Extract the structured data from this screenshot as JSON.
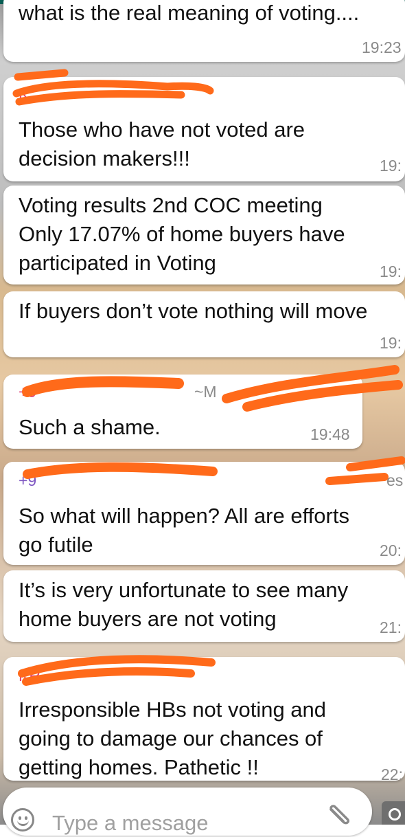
{
  "messages": [
    {
      "id": "m1",
      "text": "what is the real meaning of voting....",
      "time": "19:23"
    },
    {
      "id": "m2",
      "sender": "K",
      "text": "Those who have not voted are\ndecision makers!!!",
      "time": "19:"
    },
    {
      "id": "m3",
      "text": "Voting results 2nd COC meeting\nOnly 17.07% of home buyers have\nparticipated in Voting",
      "time": "19:"
    },
    {
      "id": "m4",
      "text": "If buyers don’t vote nothing will move",
      "time": "19:"
    },
    {
      "id": "m5",
      "sender": "+9",
      "alias": "~M",
      "text": "Such a shame.",
      "time": "19:48"
    },
    {
      "id": "m6",
      "sender": "+9",
      "alias": "~",
      "alias_tail": "es",
      "text": "So what will happen? All are efforts\ngo futile",
      "time": "20:"
    },
    {
      "id": "m7",
      "text": "It’s is very unfortunate to see many\nhome buyers are not voting",
      "time": "21:"
    },
    {
      "id": "m8",
      "sender": "KR",
      "text": "Irresponsible HBs not voting and\ngoing to damage our chances of\ngetting homes. Pathetic !!",
      "time": "22:"
    }
  ],
  "composer": {
    "placeholder": "Type a message",
    "emoji_icon": "smiley-icon",
    "attach_icon": "paperclip-icon",
    "camera_icon": "camera-icon"
  },
  "colors": {
    "header": "#075e54",
    "bubble": "#ffffff",
    "time": "#8a8a8a",
    "sender_pink": "#e0447a",
    "sender_purple": "#7e57c2",
    "redaction": "#ff6a1a"
  }
}
